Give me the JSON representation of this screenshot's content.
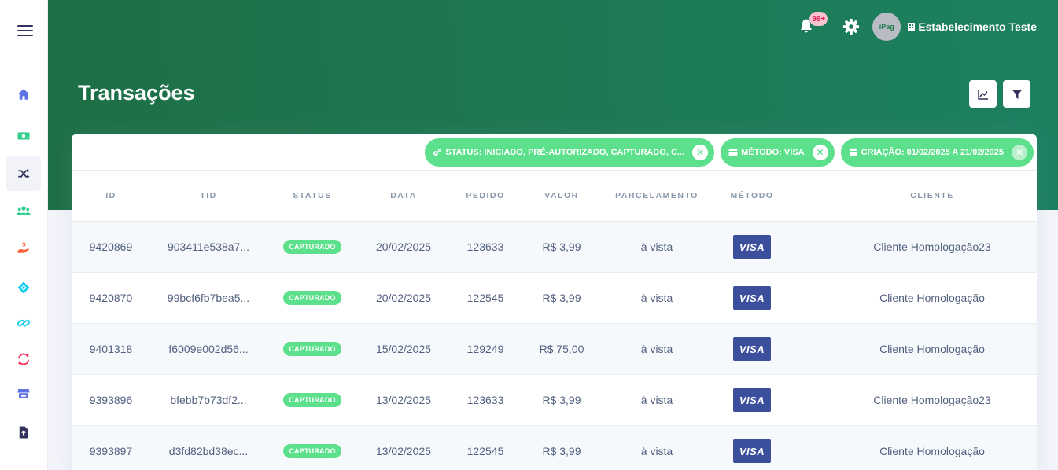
{
  "header": {
    "page_title": "Transações",
    "notifications_badge": "99+",
    "avatar_text": "iPag",
    "store_name": "Estabelecimento Teste"
  },
  "filters": [
    {
      "label": "STATUS: INICIADO, PRÉ-AUTORIZADO, CAPTURADO, C...",
      "icon": "gears-icon"
    },
    {
      "label": "MÉTODO: VISA",
      "icon": "credit-card-icon"
    },
    {
      "label": "CRIAÇÃO: 01/02/2025 A 21/02/2025",
      "icon": "calendar-icon"
    }
  ],
  "table": {
    "columns": [
      "ID",
      "TID",
      "STATUS",
      "DATA",
      "PEDIDO",
      "VALOR",
      "PARCELAMENTO",
      "MÉTODO",
      "CLIENTE"
    ],
    "rows": [
      {
        "id": "9420869",
        "tid": "903411e538a7...",
        "status": "CAPTURADO",
        "data": "20/02/2025",
        "pedido": "123633",
        "valor": "R$ 3,99",
        "parcelamento": "à vista",
        "metodo": "VISA",
        "cliente": "Cliente Homologação23"
      },
      {
        "id": "9420870",
        "tid": "99bcf6fb7bea5...",
        "status": "CAPTURADO",
        "data": "20/02/2025",
        "pedido": "122545",
        "valor": "R$ 3,99",
        "parcelamento": "à vista",
        "metodo": "VISA",
        "cliente": "Cliente Homologação"
      },
      {
        "id": "9401318",
        "tid": "f6009e002d56...",
        "status": "CAPTURADO",
        "data": "15/02/2025",
        "pedido": "129249",
        "valor": "R$ 75,00",
        "parcelamento": "à vista",
        "metodo": "VISA",
        "cliente": "Cliente Homologação"
      },
      {
        "id": "9393896",
        "tid": "bfebb7b73df2...",
        "status": "CAPTURADO",
        "data": "13/02/2025",
        "pedido": "123633",
        "valor": "R$ 3,99",
        "parcelamento": "à vista",
        "metodo": "VISA",
        "cliente": "Cliente Homologação23"
      },
      {
        "id": "9393897",
        "tid": "d3fd82bd38ec...",
        "status": "CAPTURADO",
        "data": "13/02/2025",
        "pedido": "122545",
        "valor": "R$ 3,99",
        "parcelamento": "à vista",
        "metodo": "VISA",
        "cliente": "Cliente Homologação"
      }
    ]
  },
  "sidebar": {
    "items": [
      {
        "icon": "home-icon",
        "color": "#5e72e4"
      },
      {
        "icon": "money-bill-icon",
        "color": "#2dce89"
      },
      {
        "icon": "shuffle-icon",
        "color": "#32325d"
      },
      {
        "icon": "users-icon",
        "color": "#2dce89"
      },
      {
        "icon": "hand-dollar-icon",
        "color": "#fb6340"
      },
      {
        "icon": "diamond-icon",
        "color": "#11cdef"
      },
      {
        "icon": "link-icon",
        "color": "#11cdef"
      },
      {
        "icon": "sync-icon",
        "color": "#f5365c"
      },
      {
        "icon": "store-icon",
        "color": "#5e72e4"
      },
      {
        "icon": "file-upload-icon",
        "color": "#32325d"
      }
    ]
  },
  "colors": {
    "header_gradient_start": "#1d6f45",
    "header_gradient_end": "#1d8061",
    "success": "#5de08c",
    "visa": "#3c4f9c"
  }
}
